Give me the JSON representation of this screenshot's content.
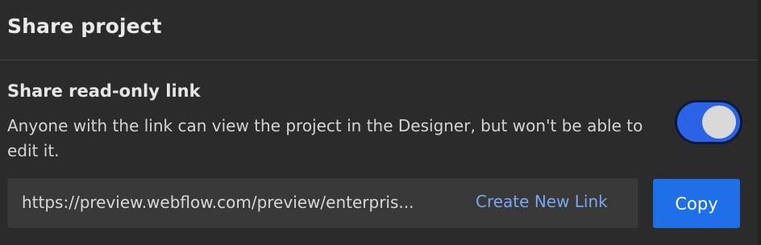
{
  "header": {
    "title": "Share project"
  },
  "share": {
    "section_title": "Share read-only link",
    "description": "Anyone with the link can view the project in the Designer, but won't be able to edit it.",
    "toggle_on": true,
    "link_url": "https://preview.webflow.com/preview/enterpris...",
    "create_new_link_label": "Create New Link",
    "copy_label": "Copy"
  },
  "colors": {
    "background": "#2b2b2b",
    "accent": "#1f6fe8",
    "toggle_track": "#2a63e6",
    "link_text": "#7aa7ee"
  }
}
